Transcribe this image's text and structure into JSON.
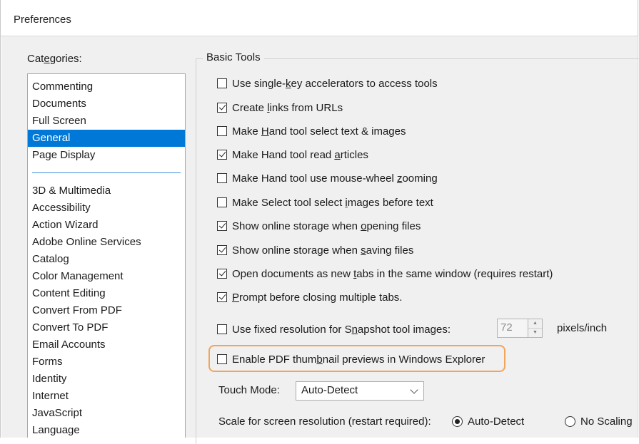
{
  "window": {
    "title": "Preferences"
  },
  "categories": {
    "label": "Categories:",
    "top_items": [
      {
        "label": "Commenting",
        "selected": false
      },
      {
        "label": "Documents",
        "selected": false
      },
      {
        "label": "Full Screen",
        "selected": false
      },
      {
        "label": "General",
        "selected": true
      },
      {
        "label": "Page Display",
        "selected": false
      }
    ],
    "items": [
      "3D & Multimedia",
      "Accessibility",
      "Action Wizard",
      "Adobe Online Services",
      "Catalog",
      "Color Management",
      "Content Editing",
      "Convert From PDF",
      "Convert To PDF",
      "Email Accounts",
      "Forms",
      "Identity",
      "Internet",
      "JavaScript",
      "Language"
    ]
  },
  "basic_tools": {
    "title": "Basic Tools",
    "options": [
      {
        "label": "Use single-key accelerators to access tools",
        "checked": false
      },
      {
        "label": "Create links from URLs",
        "checked": true
      },
      {
        "label": "Make Hand tool select text & images",
        "checked": false
      },
      {
        "label": "Make Hand tool read articles",
        "checked": true
      },
      {
        "label": "Make Hand tool use mouse-wheel zooming",
        "checked": false
      },
      {
        "label": "Make Select tool select images before text",
        "checked": false
      },
      {
        "label": "Show online storage when opening files",
        "checked": true
      },
      {
        "label": "Show online storage when saving files",
        "checked": true
      },
      {
        "label": "Open documents as new tabs in the same window (requires restart)",
        "checked": true
      },
      {
        "label": "Prompt before closing multiple tabs.",
        "checked": true
      }
    ],
    "snapshot": {
      "label": "Use fixed resolution for Snapshot tool images:",
      "checked": false,
      "value": "72",
      "unit": "pixels/inch"
    },
    "thumbnail": {
      "label": "Enable PDF thumbnail previews in Windows Explorer",
      "checked": false,
      "highlight_color": "#f2a55a"
    },
    "touch_mode": {
      "label": "Touch Mode:",
      "value": "Auto-Detect"
    },
    "scale": {
      "label": "Scale for screen resolution (restart required):",
      "options": [
        {
          "label": "Auto-Detect",
          "selected": true
        },
        {
          "label": "No Scaling",
          "selected": false
        }
      ]
    }
  },
  "colors": {
    "selection": "#0078d7",
    "separator": "#3c8fd6",
    "highlight": "#f2a55a"
  }
}
